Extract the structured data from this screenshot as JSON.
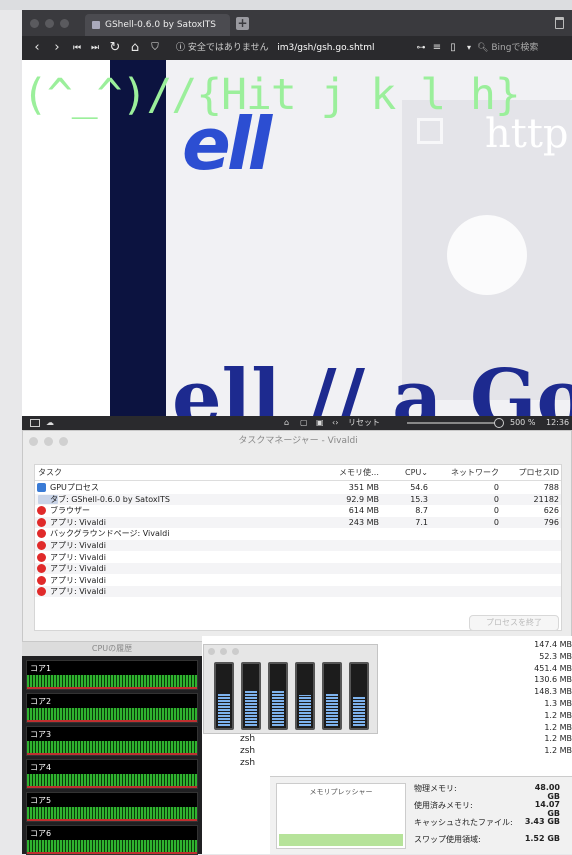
{
  "browser": {
    "tab_title": "GShell-0.6.0 by SatoxITS",
    "url_warning": "安全ではありません",
    "url": "im3/gsh/gsh.go.shtml",
    "search_placeholder": "Bingで検索",
    "overlay_text": "(^_^)//{Hit j k l h}",
    "page_text_top": "ell",
    "page_text_bottom": "ell // a Go",
    "page_text_http": "http",
    "status_reset": "リセット",
    "zoom": "500 %",
    "clock": "12:36"
  },
  "task_manager": {
    "title": "タスクマネージャー - Vivaldi",
    "columns": {
      "task": "タスク",
      "memory": "メモリ使…",
      "cpu": "CPU⌄",
      "network": "ネットワーク",
      "pid": "プロセスID"
    },
    "rows": [
      {
        "name": "GPUプロセス",
        "memory": "351 MB",
        "cpu": "54.6",
        "network": "0",
        "pid": "788",
        "icon": "puzzle-icon"
      },
      {
        "name": "タブ: GShell-0.6.0 by SatoxITS",
        "memory": "92.9 MB",
        "cpu": "15.3",
        "network": "0",
        "pid": "21182",
        "icon": "tab-icon"
      },
      {
        "name": "ブラウザー",
        "memory": "614 MB",
        "cpu": "8.7",
        "network": "0",
        "pid": "626",
        "icon": "vivaldi-icon"
      },
      {
        "name": "アプリ: Vivaldi",
        "memory": "243 MB",
        "cpu": "7.1",
        "network": "0",
        "pid": "796",
        "icon": "vivaldi-icon"
      },
      {
        "name": "バックグラウンドページ: Vivaldi",
        "memory": "",
        "cpu": "",
        "network": "",
        "pid": "",
        "icon": "vivaldi-icon"
      },
      {
        "name": "アプリ: Vivaldi",
        "memory": "",
        "cpu": "",
        "network": "",
        "pid": "",
        "icon": "vivaldi-icon"
      },
      {
        "name": "アプリ: Vivaldi",
        "memory": "",
        "cpu": "",
        "network": "",
        "pid": "",
        "icon": "vivaldi-icon"
      },
      {
        "name": "アプリ: Vivaldi",
        "memory": "",
        "cpu": "",
        "network": "",
        "pid": "",
        "icon": "vivaldi-icon"
      },
      {
        "name": "アプリ: Vivaldi",
        "memory": "",
        "cpu": "",
        "network": "",
        "pid": "",
        "icon": "vivaldi-icon"
      },
      {
        "name": "アプリ: Vivaldi",
        "memory": "",
        "cpu": "",
        "network": "",
        "pid": "",
        "icon": "vivaldi-icon"
      }
    ],
    "end_process": "プロセスを終了"
  },
  "cpu_history": {
    "title": "CPUの履歴",
    "cores": [
      "コア1",
      "コア2",
      "コア3",
      "コア4",
      "コア5",
      "コア6"
    ]
  },
  "cpu_meter": {
    "levels": [
      0.55,
      0.6,
      0.58,
      0.52,
      0.55,
      0.5
    ]
  },
  "activity": {
    "memory_list": [
      "147.4 MB",
      "52.3 MB",
      "451.4 MB",
      "130.6 MB",
      "148.3 MB",
      "1.3 MB",
      "1.2 MB",
      "1.2 MB",
      "1.2 MB",
      "1.2 MB"
    ],
    "procs": [
      "zsh",
      "zsh",
      "zsh"
    ],
    "pressure_label": "メモリプレッシャー",
    "stats": [
      {
        "label": "物理メモリ:",
        "value": "48.00 GB"
      },
      {
        "label": "使用済みメモリ:",
        "value": "14.07 GB"
      },
      {
        "label": "キャッシュされたファイル:",
        "value": "3.43 GB"
      },
      {
        "label": "スワップ使用領域:",
        "value": "1.52 GB"
      }
    ]
  }
}
